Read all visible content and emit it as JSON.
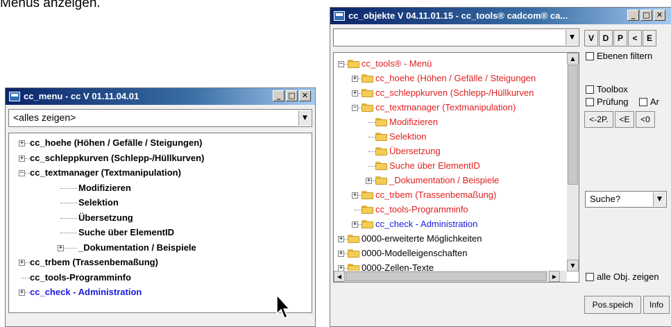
{
  "caption": "Menüs anzeigen.",
  "left_window": {
    "title": "cc_menu - cc V 01.11.04.01",
    "combo_value": "<alles zeigen>",
    "items": [
      {
        "label": "cc_hoehe  (Höhen / Gefälle / Steigungen)",
        "level": 0,
        "expander": "+",
        "color": "#000000"
      },
      {
        "label": "cc_schleppkurven  (Schlepp-/Hüllkurven)",
        "level": 0,
        "expander": "+",
        "color": "#000000"
      },
      {
        "label": "cc_textmanager  (Textmanipulation)",
        "level": 0,
        "expander": "-",
        "color": "#000000"
      },
      {
        "label": "Modifizieren",
        "level": 1,
        "expander": "",
        "color": "#000000"
      },
      {
        "label": "Selektion",
        "level": 1,
        "expander": "",
        "color": "#000000"
      },
      {
        "label": "Übersetzung",
        "level": 1,
        "expander": "",
        "color": "#000000"
      },
      {
        "label": "Suche über ElementID",
        "level": 1,
        "expander": "",
        "color": "#000000"
      },
      {
        "label": "_Dokumentation / Beispiele",
        "level": 1,
        "expander": "+",
        "color": "#000000"
      },
      {
        "label": "cc_trbem  (Trassenbemaßung)",
        "level": 0,
        "expander": "+",
        "color": "#000000"
      },
      {
        "label": "cc_tools-Programminfo",
        "level": 0,
        "expander": "",
        "color": "#000000"
      },
      {
        "label": "cc_check - Administration",
        "level": 0,
        "expander": "+",
        "color": "#1a1adc"
      }
    ]
  },
  "right_window": {
    "title": "cc_objekte V 04.11.01.15 -  cc_tools® cadcom® ca...",
    "combo_value": "",
    "tree_items": [
      {
        "label": "cc_tools® - Menü",
        "level": 0,
        "expander": "-",
        "color": "#e02020"
      },
      {
        "label": "cc_hoehe  (Höhen / Gefälle / Steigungen",
        "level": 1,
        "expander": "+",
        "color": "#e02020"
      },
      {
        "label": "cc_schleppkurven  (Schlepp-/Hüllkurven",
        "level": 1,
        "expander": "+",
        "color": "#e02020"
      },
      {
        "label": "cc_textmanager  (Textmanipulation)",
        "level": 1,
        "expander": "-",
        "color": "#e02020"
      },
      {
        "label": "Modifizieren",
        "level": 2,
        "expander": "",
        "color": "#e02020"
      },
      {
        "label": "Selektion",
        "level": 2,
        "expander": "",
        "color": "#e02020"
      },
      {
        "label": "Übersetzung",
        "level": 2,
        "expander": "",
        "color": "#e02020"
      },
      {
        "label": "Suche über ElementID",
        "level": 2,
        "expander": "",
        "color": "#e02020"
      },
      {
        "label": "_Dokumentation / Beispiele",
        "level": 2,
        "expander": "+",
        "color": "#e02020"
      },
      {
        "label": "cc_trbem  (Trassenbemaßung)",
        "level": 1,
        "expander": "+",
        "color": "#e02020"
      },
      {
        "label": "cc_tools-Programminfo",
        "level": 1,
        "expander": "",
        "color": "#e02020"
      },
      {
        "label": "cc_check - Administration",
        "level": 1,
        "expander": "+",
        "color": "#1a1adc"
      },
      {
        "label": "0000-erweiterte Möglichkeiten",
        "level": 0,
        "expander": "+",
        "color": "#000000"
      },
      {
        "label": "0000-Modelleigenschaften",
        "level": 0,
        "expander": "+",
        "color": "#000000"
      },
      {
        "label": "0000-Zellen-Texte",
        "level": 0,
        "expander": "+",
        "color": "#000000"
      }
    ],
    "panel": {
      "small_buttons": [
        "V",
        "D",
        "P",
        "<",
        "E"
      ],
      "ebenen_filtern": "Ebenen filtern",
      "toolbox": "Toolbox",
      "pruefung": "Prüfung",
      "cut_check": "Ar",
      "nav_buttons": [
        "<-2P.",
        "<E",
        "<0"
      ],
      "suche": "Suche?",
      "alle_obj": "alle Obj. zeigen",
      "pos_speich": "Pos.speich",
      "info": "Info"
    }
  },
  "colors": {
    "red": "#e02020",
    "blue": "#1a1adc",
    "title_start": "#0a246a"
  }
}
